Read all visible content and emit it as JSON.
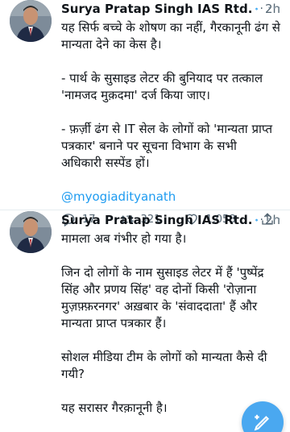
{
  "tweets": [
    {
      "author": "Surya Pratap Singh IAS Rtd.",
      "separator": "·",
      "time": "2h",
      "more": "···",
      "paragraphs": [
        "यह सिर्फ बच्चे के शोषण का नहीं, गैरकानूनी ढंग से मान्यता देने का केस है।",
        "- पार्थ के सुसाइड लेटर की बुनियाद पर तत्काल 'नामजद मुक़दमा' दर्ज किया जाए।",
        "- फ़र्ज़ी ढंग से IT सेल के लोगों को 'मान्यता प्राप्त पत्रकार' बनाने पर सूचना विभाग के सभी अधिकारी सस्पेंड हों।"
      ],
      "mention": "@myogiadityanath",
      "stats": {
        "replies": "17",
        "retweets": "321",
        "likes": "1,058"
      }
    },
    {
      "author": "Surya Pratap Singh IAS Rtd.",
      "separator": "·",
      "time": "2h",
      "more": "···",
      "paragraphs": [
        "मामला अब गंभीर हो गया है।",
        "जिन दो लोगों के नाम सुसाइड लेटर में हैं 'पुष्पेंद्र सिंह और प्रणय सिंह' वह दोनों किसी 'रोज़ाना मुज़फ़्फ़रनगर' अख़बार के 'संवाददाता' हैं और मान्यता प्राप्त पत्रकार हैं।",
        "सोशल मीडिया टीम के लोगों को मान्यता कैसे दी गयी?",
        "यह सरासर गैरक़ानूनी है।"
      ]
    }
  ],
  "colors": {
    "link": "#1d9bf0",
    "fab": "#4aa8f0",
    "muted": "#536471"
  },
  "icons": [
    "verified-badge-icon",
    "reply-icon",
    "retweet-icon",
    "like-icon",
    "share-icon",
    "compose-tweet-icon"
  ]
}
